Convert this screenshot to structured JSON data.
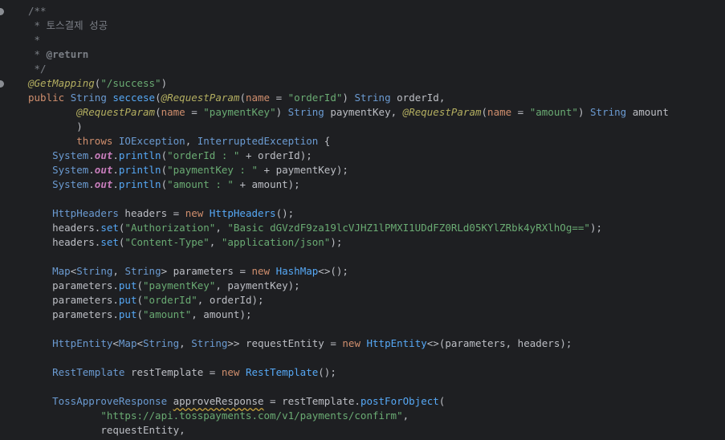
{
  "editor": {
    "colors": {
      "background": "#1e1f22",
      "comment": "#7a7e85",
      "keyword": "#cf8e6d",
      "type": "#6b9bd2",
      "method": "#56a8f5",
      "string": "#6aab73",
      "annotation": "#b3ae60",
      "static_field": "#c77dbb",
      "default_text": "#bcbec4"
    },
    "gutter_icons": [
      "implementation-marker-icon",
      "implementation-marker-icon"
    ],
    "lines": [
      {
        "indent": 0,
        "tokens": [
          {
            "c": "comment",
            "t": "/**"
          }
        ]
      },
      {
        "indent": 1,
        "tokens": [
          {
            "c": "comment",
            "t": "* 토스결제 성공"
          }
        ]
      },
      {
        "indent": 1,
        "tokens": [
          {
            "c": "comment",
            "t": "*"
          }
        ]
      },
      {
        "indent": 1,
        "tokens": [
          {
            "c": "comment",
            "t": "* "
          },
          {
            "c": "doctag",
            "t": "@return"
          }
        ]
      },
      {
        "indent": 1,
        "tokens": [
          {
            "c": "comment",
            "t": "*/"
          }
        ]
      },
      {
        "indent": 0,
        "tokens": [
          {
            "c": "annot",
            "t": "@GetMapping"
          },
          {
            "c": "var",
            "t": "("
          },
          {
            "c": "str",
            "t": "\"/success\""
          },
          {
            "c": "var",
            "t": ")"
          }
        ]
      },
      {
        "indent": 0,
        "tokens": [
          {
            "c": "kw",
            "t": "public "
          },
          {
            "c": "type",
            "t": "String "
          },
          {
            "c": "method",
            "t": "seccese"
          },
          {
            "c": "var",
            "t": "("
          },
          {
            "c": "annot",
            "t": "@RequestParam"
          },
          {
            "c": "var",
            "t": "("
          },
          {
            "c": "param-name",
            "t": "name"
          },
          {
            "c": "var",
            "t": " = "
          },
          {
            "c": "str",
            "t": "\"orderId\""
          },
          {
            "c": "var",
            "t": ") "
          },
          {
            "c": "type",
            "t": "String "
          },
          {
            "c": "param",
            "t": "orderId"
          },
          {
            "c": "var",
            "t": ","
          }
        ]
      },
      {
        "indent": 8,
        "tokens": [
          {
            "c": "annot",
            "t": "@RequestParam"
          },
          {
            "c": "var",
            "t": "("
          },
          {
            "c": "param-name",
            "t": "name"
          },
          {
            "c": "var",
            "t": " = "
          },
          {
            "c": "str",
            "t": "\"paymentKey\""
          },
          {
            "c": "var",
            "t": ") "
          },
          {
            "c": "type",
            "t": "String "
          },
          {
            "c": "param",
            "t": "paymentKey"
          },
          {
            "c": "var",
            "t": ", "
          },
          {
            "c": "annot",
            "t": "@RequestParam"
          },
          {
            "c": "var",
            "t": "("
          },
          {
            "c": "param-name",
            "t": "name"
          },
          {
            "c": "var",
            "t": " = "
          },
          {
            "c": "str",
            "t": "\"amount\""
          },
          {
            "c": "var",
            "t": ") "
          },
          {
            "c": "type",
            "t": "String "
          },
          {
            "c": "param",
            "t": "amount"
          }
        ]
      },
      {
        "indent": 8,
        "tokens": [
          {
            "c": "var",
            "t": ")"
          }
        ]
      },
      {
        "indent": 8,
        "tokens": [
          {
            "c": "kw",
            "t": "throws "
          },
          {
            "c": "type",
            "t": "IOException"
          },
          {
            "c": "var",
            "t": ", "
          },
          {
            "c": "type",
            "t": "InterruptedException"
          },
          {
            "c": "var",
            "t": " {"
          }
        ]
      },
      {
        "indent": 4,
        "tokens": [
          {
            "c": "type",
            "t": "System"
          },
          {
            "c": "var",
            "t": "."
          },
          {
            "c": "field",
            "t": "out"
          },
          {
            "c": "var",
            "t": "."
          },
          {
            "c": "method",
            "t": "println"
          },
          {
            "c": "var",
            "t": "("
          },
          {
            "c": "str",
            "t": "\"orderId : \""
          },
          {
            "c": "var",
            "t": " + "
          },
          {
            "c": "local",
            "t": "orderId"
          },
          {
            "c": "var",
            "t": ");"
          }
        ]
      },
      {
        "indent": 4,
        "tokens": [
          {
            "c": "type",
            "t": "System"
          },
          {
            "c": "var",
            "t": "."
          },
          {
            "c": "field",
            "t": "out"
          },
          {
            "c": "var",
            "t": "."
          },
          {
            "c": "method",
            "t": "println"
          },
          {
            "c": "var",
            "t": "("
          },
          {
            "c": "str",
            "t": "\"paymentKey : \""
          },
          {
            "c": "var",
            "t": " + "
          },
          {
            "c": "local",
            "t": "paymentKey"
          },
          {
            "c": "var",
            "t": ");"
          }
        ]
      },
      {
        "indent": 4,
        "tokens": [
          {
            "c": "type",
            "t": "System"
          },
          {
            "c": "var",
            "t": "."
          },
          {
            "c": "field",
            "t": "out"
          },
          {
            "c": "var",
            "t": "."
          },
          {
            "c": "method",
            "t": "println"
          },
          {
            "c": "var",
            "t": "("
          },
          {
            "c": "str",
            "t": "\"amount : \""
          },
          {
            "c": "var",
            "t": " + "
          },
          {
            "c": "local",
            "t": "amount"
          },
          {
            "c": "var",
            "t": ");"
          }
        ]
      },
      {
        "indent": 0,
        "tokens": []
      },
      {
        "indent": 4,
        "tokens": [
          {
            "c": "type",
            "t": "HttpHeaders "
          },
          {
            "c": "local",
            "t": "headers"
          },
          {
            "c": "var",
            "t": " = "
          },
          {
            "c": "kw",
            "t": "new "
          },
          {
            "c": "method",
            "t": "HttpHeaders"
          },
          {
            "c": "var",
            "t": "();"
          }
        ]
      },
      {
        "indent": 4,
        "tokens": [
          {
            "c": "local",
            "t": "headers"
          },
          {
            "c": "var",
            "t": "."
          },
          {
            "c": "method",
            "t": "set"
          },
          {
            "c": "var",
            "t": "("
          },
          {
            "c": "str",
            "t": "\"Authorization\""
          },
          {
            "c": "var",
            "t": ", "
          },
          {
            "c": "str",
            "t": "\"Basic dGVzdF9za19lcVJHZ1lPMXI1UDdFZ0RLd05KYlZRbk4yRXlhOg==\""
          },
          {
            "c": "var",
            "t": ");"
          }
        ]
      },
      {
        "indent": 4,
        "tokens": [
          {
            "c": "local",
            "t": "headers"
          },
          {
            "c": "var",
            "t": "."
          },
          {
            "c": "method",
            "t": "set"
          },
          {
            "c": "var",
            "t": "("
          },
          {
            "c": "str",
            "t": "\"Content-Type\""
          },
          {
            "c": "var",
            "t": ", "
          },
          {
            "c": "str",
            "t": "\"application/json\""
          },
          {
            "c": "var",
            "t": ");"
          }
        ]
      },
      {
        "indent": 0,
        "tokens": []
      },
      {
        "indent": 4,
        "tokens": [
          {
            "c": "type",
            "t": "Map"
          },
          {
            "c": "var",
            "t": "<"
          },
          {
            "c": "type",
            "t": "String"
          },
          {
            "c": "var",
            "t": ", "
          },
          {
            "c": "type",
            "t": "String"
          },
          {
            "c": "var",
            "t": "> "
          },
          {
            "c": "local",
            "t": "parameters"
          },
          {
            "c": "var",
            "t": " = "
          },
          {
            "c": "kw",
            "t": "new "
          },
          {
            "c": "method",
            "t": "HashMap"
          },
          {
            "c": "var",
            "t": "<>();"
          }
        ]
      },
      {
        "indent": 4,
        "tokens": [
          {
            "c": "local",
            "t": "parameters"
          },
          {
            "c": "var",
            "t": "."
          },
          {
            "c": "method",
            "t": "put"
          },
          {
            "c": "var",
            "t": "("
          },
          {
            "c": "str",
            "t": "\"paymentKey\""
          },
          {
            "c": "var",
            "t": ", "
          },
          {
            "c": "local",
            "t": "paymentKey"
          },
          {
            "c": "var",
            "t": ");"
          }
        ]
      },
      {
        "indent": 4,
        "tokens": [
          {
            "c": "local",
            "t": "parameters"
          },
          {
            "c": "var",
            "t": "."
          },
          {
            "c": "method",
            "t": "put"
          },
          {
            "c": "var",
            "t": "("
          },
          {
            "c": "str",
            "t": "\"orderId\""
          },
          {
            "c": "var",
            "t": ", "
          },
          {
            "c": "local",
            "t": "orderId"
          },
          {
            "c": "var",
            "t": ");"
          }
        ]
      },
      {
        "indent": 4,
        "tokens": [
          {
            "c": "local",
            "t": "parameters"
          },
          {
            "c": "var",
            "t": "."
          },
          {
            "c": "method",
            "t": "put"
          },
          {
            "c": "var",
            "t": "("
          },
          {
            "c": "str",
            "t": "\"amount\""
          },
          {
            "c": "var",
            "t": ", "
          },
          {
            "c": "local",
            "t": "amount"
          },
          {
            "c": "var",
            "t": ");"
          }
        ]
      },
      {
        "indent": 0,
        "tokens": []
      },
      {
        "indent": 4,
        "tokens": [
          {
            "c": "type",
            "t": "HttpEntity"
          },
          {
            "c": "var",
            "t": "<"
          },
          {
            "c": "type",
            "t": "Map"
          },
          {
            "c": "var",
            "t": "<"
          },
          {
            "c": "type",
            "t": "String"
          },
          {
            "c": "var",
            "t": ", "
          },
          {
            "c": "type",
            "t": "String"
          },
          {
            "c": "var",
            "t": ">> "
          },
          {
            "c": "local",
            "t": "requestEntity"
          },
          {
            "c": "var",
            "t": " = "
          },
          {
            "c": "kw",
            "t": "new "
          },
          {
            "c": "method",
            "t": "HttpEntity"
          },
          {
            "c": "var",
            "t": "<>("
          },
          {
            "c": "local",
            "t": "parameters"
          },
          {
            "c": "var",
            "t": ", "
          },
          {
            "c": "local",
            "t": "headers"
          },
          {
            "c": "var",
            "t": ");"
          }
        ]
      },
      {
        "indent": 0,
        "tokens": []
      },
      {
        "indent": 4,
        "tokens": [
          {
            "c": "type",
            "t": "RestTemplate "
          },
          {
            "c": "local",
            "t": "restTemplate"
          },
          {
            "c": "var",
            "t": " = "
          },
          {
            "c": "kw",
            "t": "new "
          },
          {
            "c": "method",
            "t": "RestTemplate"
          },
          {
            "c": "var",
            "t": "();"
          }
        ]
      },
      {
        "indent": 0,
        "tokens": []
      },
      {
        "indent": 4,
        "tokens": [
          {
            "c": "type",
            "t": "TossApproveResponse "
          },
          {
            "c": "local typo",
            "t": "approveResponse"
          },
          {
            "c": "var",
            "t": " = "
          },
          {
            "c": "local",
            "t": "restTemplate"
          },
          {
            "c": "var",
            "t": "."
          },
          {
            "c": "method",
            "t": "postForObject"
          },
          {
            "c": "var",
            "t": "("
          }
        ]
      },
      {
        "indent": 12,
        "tokens": [
          {
            "c": "str",
            "t": "\"https://api.tosspayments.com/v1/payments/confirm\""
          },
          {
            "c": "var",
            "t": ","
          }
        ]
      },
      {
        "indent": 12,
        "tokens": [
          {
            "c": "local",
            "t": "requestEntity"
          },
          {
            "c": "var",
            "t": ","
          }
        ]
      }
    ]
  }
}
